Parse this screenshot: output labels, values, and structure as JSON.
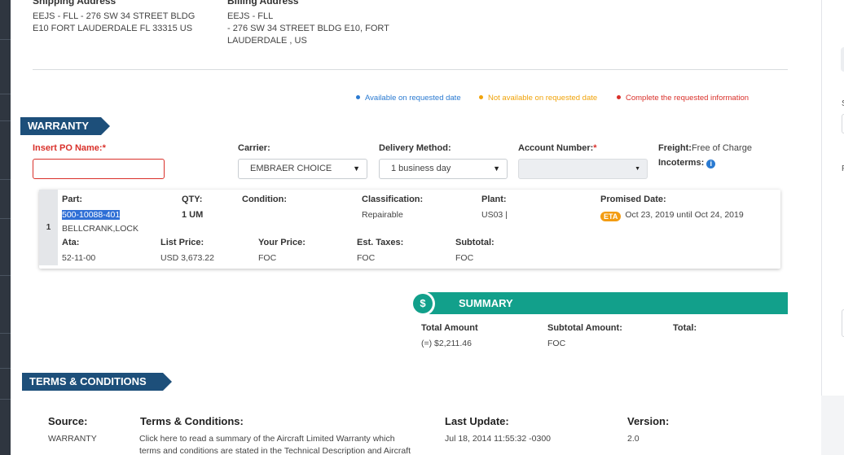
{
  "shipping": {
    "title": "Shipping Address",
    "line1": "EEJS - FLL - 276 SW 34 STREET BLDG",
    "line2": "E10 FORT LAUDERDALE FL 33315 US"
  },
  "billing": {
    "title": "Billing Address",
    "line1": "EEJS - FLL",
    "line2": "- 276 SW 34 STREET BLDG E10, FORT",
    "line3": "LAUDERDALE , US"
  },
  "legend": {
    "available": "Available on requested date",
    "not_available": "Not available on requested date",
    "complete": "Complete the requested information",
    "colors": {
      "available": "#2a7ad1",
      "not_available": "#f0a30a",
      "complete": "#d9302a"
    }
  },
  "warranty": {
    "title": "WARRANTY",
    "po_label": "Insert PO Name:",
    "po_value": "",
    "carrier_label": "Carrier:",
    "carrier_value": "EMBRAER CHOICE",
    "delivery_label": "Delivery Method:",
    "delivery_value": "1 business day",
    "account_label": "Account Number:",
    "account_value": "",
    "required_mark": "*",
    "freight_label": "Freight:",
    "freight_value": "Free of Charge",
    "incoterms_label": "Incoterms:"
  },
  "part": {
    "index": "1",
    "part_label": "Part:",
    "part_number": "500-10088-401",
    "part_desc": "BELLCRANK,LOCK",
    "qty_label": "QTY:",
    "qty_value": "1 UM",
    "condition_label": "Condition:",
    "condition_value": "",
    "classification_label": "Classification:",
    "classification_value": "Repairable",
    "plant_label": "Plant:",
    "plant_value": "US03 |",
    "promised_label": "Promised Date:",
    "eta_badge": "ETA",
    "promised_value": "Oct 23, 2019 until Oct 24, 2019",
    "ata_label": "Ata:",
    "ata_value": "52-11-00",
    "list_price_label": "List Price:",
    "list_price_value": "USD 3,673.22",
    "your_price_label": "Your Price:",
    "your_price_value": "FOC",
    "taxes_label": "Est. Taxes:",
    "taxes_value": "FOC",
    "subtotal_label": "Subtotal:",
    "subtotal_value": "FOC"
  },
  "summary": {
    "icon": "$",
    "title": "SUMMARY",
    "total_amount_label": "Total Amount",
    "total_amount_value": "(=) $2,211.46",
    "subtotal_label": "Subtotal Amount:",
    "subtotal_value": "FOC",
    "total_label": "Total:",
    "total_value": ""
  },
  "terms": {
    "title": "TERMS & CONDITIONS",
    "source_label": "Source:",
    "source_value": "WARRANTY",
    "tc_label": "Terms & Conditions:",
    "tc_line1": "Click here to read a summary of the Aircraft Limited Warranty which",
    "tc_line2": "terms and conditions are stated in the Technical Description and Aircraft",
    "update_label": "Last Update:",
    "update_value": "Jul 18, 2014 11:55:32 -0300",
    "version_label": "Version:",
    "version_value": "2.0"
  },
  "right_panel": {
    "letter_s": "S",
    "letter_f": "F"
  }
}
